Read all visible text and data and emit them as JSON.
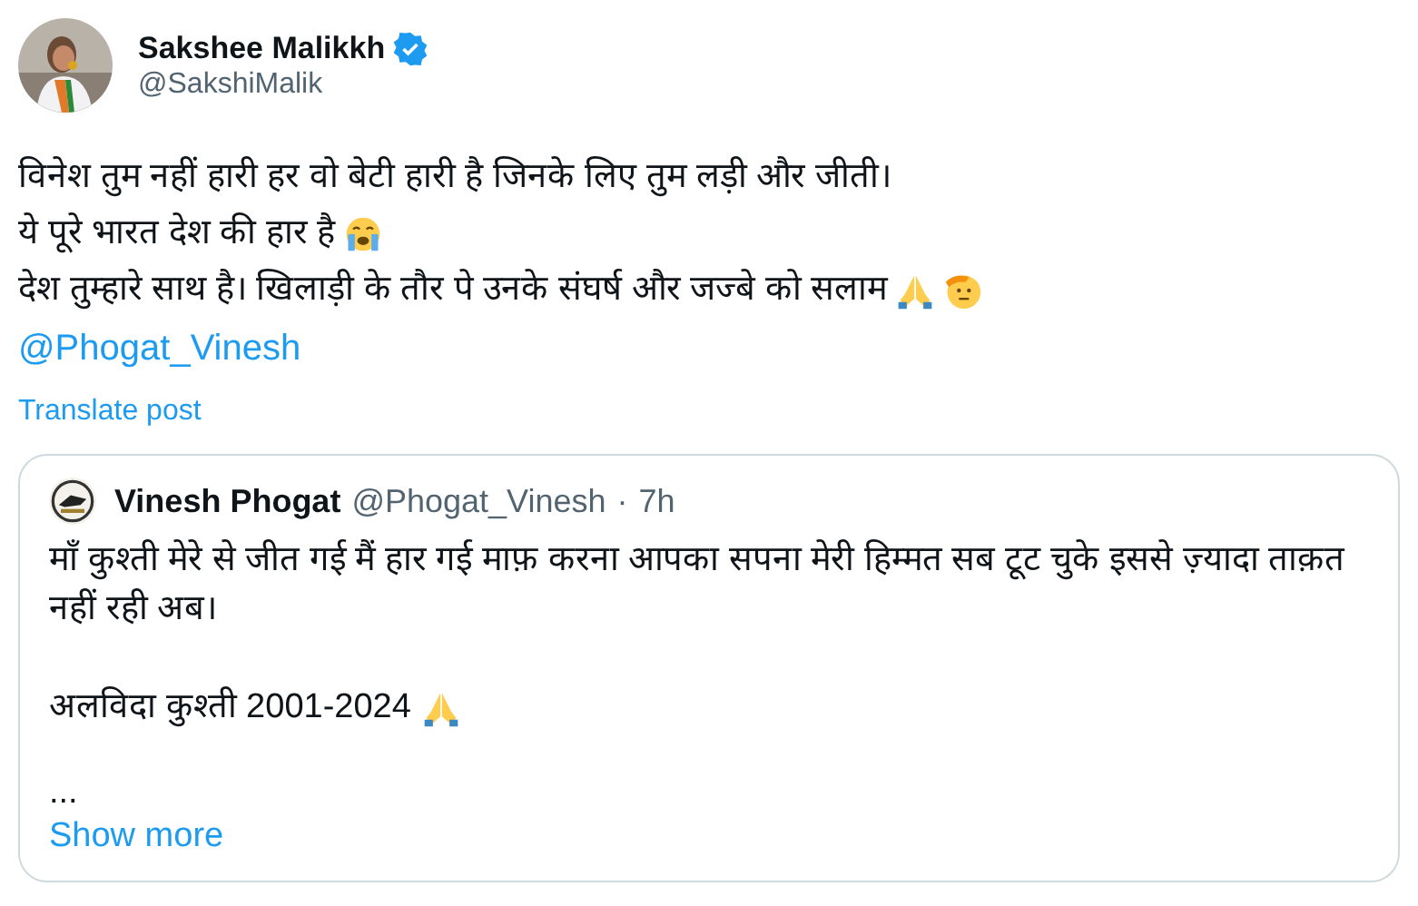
{
  "author": {
    "name": "Sakshee Malikkh",
    "verified": true,
    "handle": "@SakshiMalik"
  },
  "lines": [
    {
      "text": "विनेश तुम नहीं हारी हर वो बेटी हारी है जिनके लिए तुम लड़ी और जीती।"
    },
    {
      "text": "ये पूरे भारत देश की हार है",
      "emojis": [
        {
          "kind": "crying"
        }
      ]
    },
    {
      "text": "देश तुम्हारे साथ है। खिलाड़ी के तौर पे उनके संघर्ष और जज्बे को सलाम",
      "emojis": [
        {
          "kind": "folded-hands"
        },
        {
          "kind": "saluting"
        }
      ]
    }
  ],
  "mention": "@Phogat_Vinesh",
  "translate": "Translate post",
  "quote": {
    "name": "Vinesh Phogat",
    "handle": "@Phogat_Vinesh",
    "separator": "·",
    "time": "7h",
    "paragraphs": [
      {
        "text": "माँ कुश्ती मेरे से जीत गई मैं हार गई माफ़ करना आपका सपना मेरी हिम्मत सब टूट चुके इससे ज़्यादा ताक़त नहीं रही अब।"
      },
      {
        "text": "अलविदा कुश्ती 2001-2024",
        "emojis": [
          {
            "kind": "folded-hands"
          }
        ]
      },
      {
        "text": "..."
      }
    ],
    "show_more": "Show more"
  }
}
